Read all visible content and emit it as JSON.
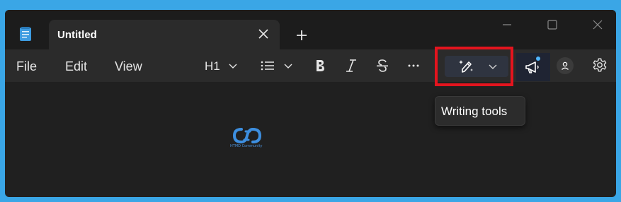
{
  "tab": {
    "title": "Untitled"
  },
  "menu": {
    "file": "File",
    "edit": "Edit",
    "view": "View"
  },
  "toolbar": {
    "heading_label": "H1",
    "tooltip": "Writing tools"
  },
  "watermark": {
    "text": "HTMD Community"
  },
  "colors": {
    "border": "#3aa6e6",
    "window_bg": "#202020",
    "highlight": "#e3141e",
    "accent": "#4fb6ff"
  },
  "icons": [
    "notepad-app-icon",
    "close-icon",
    "plus-icon",
    "minimize-icon",
    "maximize-icon",
    "window-close-icon",
    "list-icon",
    "bold-icon",
    "italic-icon",
    "strikethrough-icon",
    "more-icon",
    "writing-tools-icon",
    "megaphone-icon",
    "account-icon",
    "gear-icon"
  ]
}
